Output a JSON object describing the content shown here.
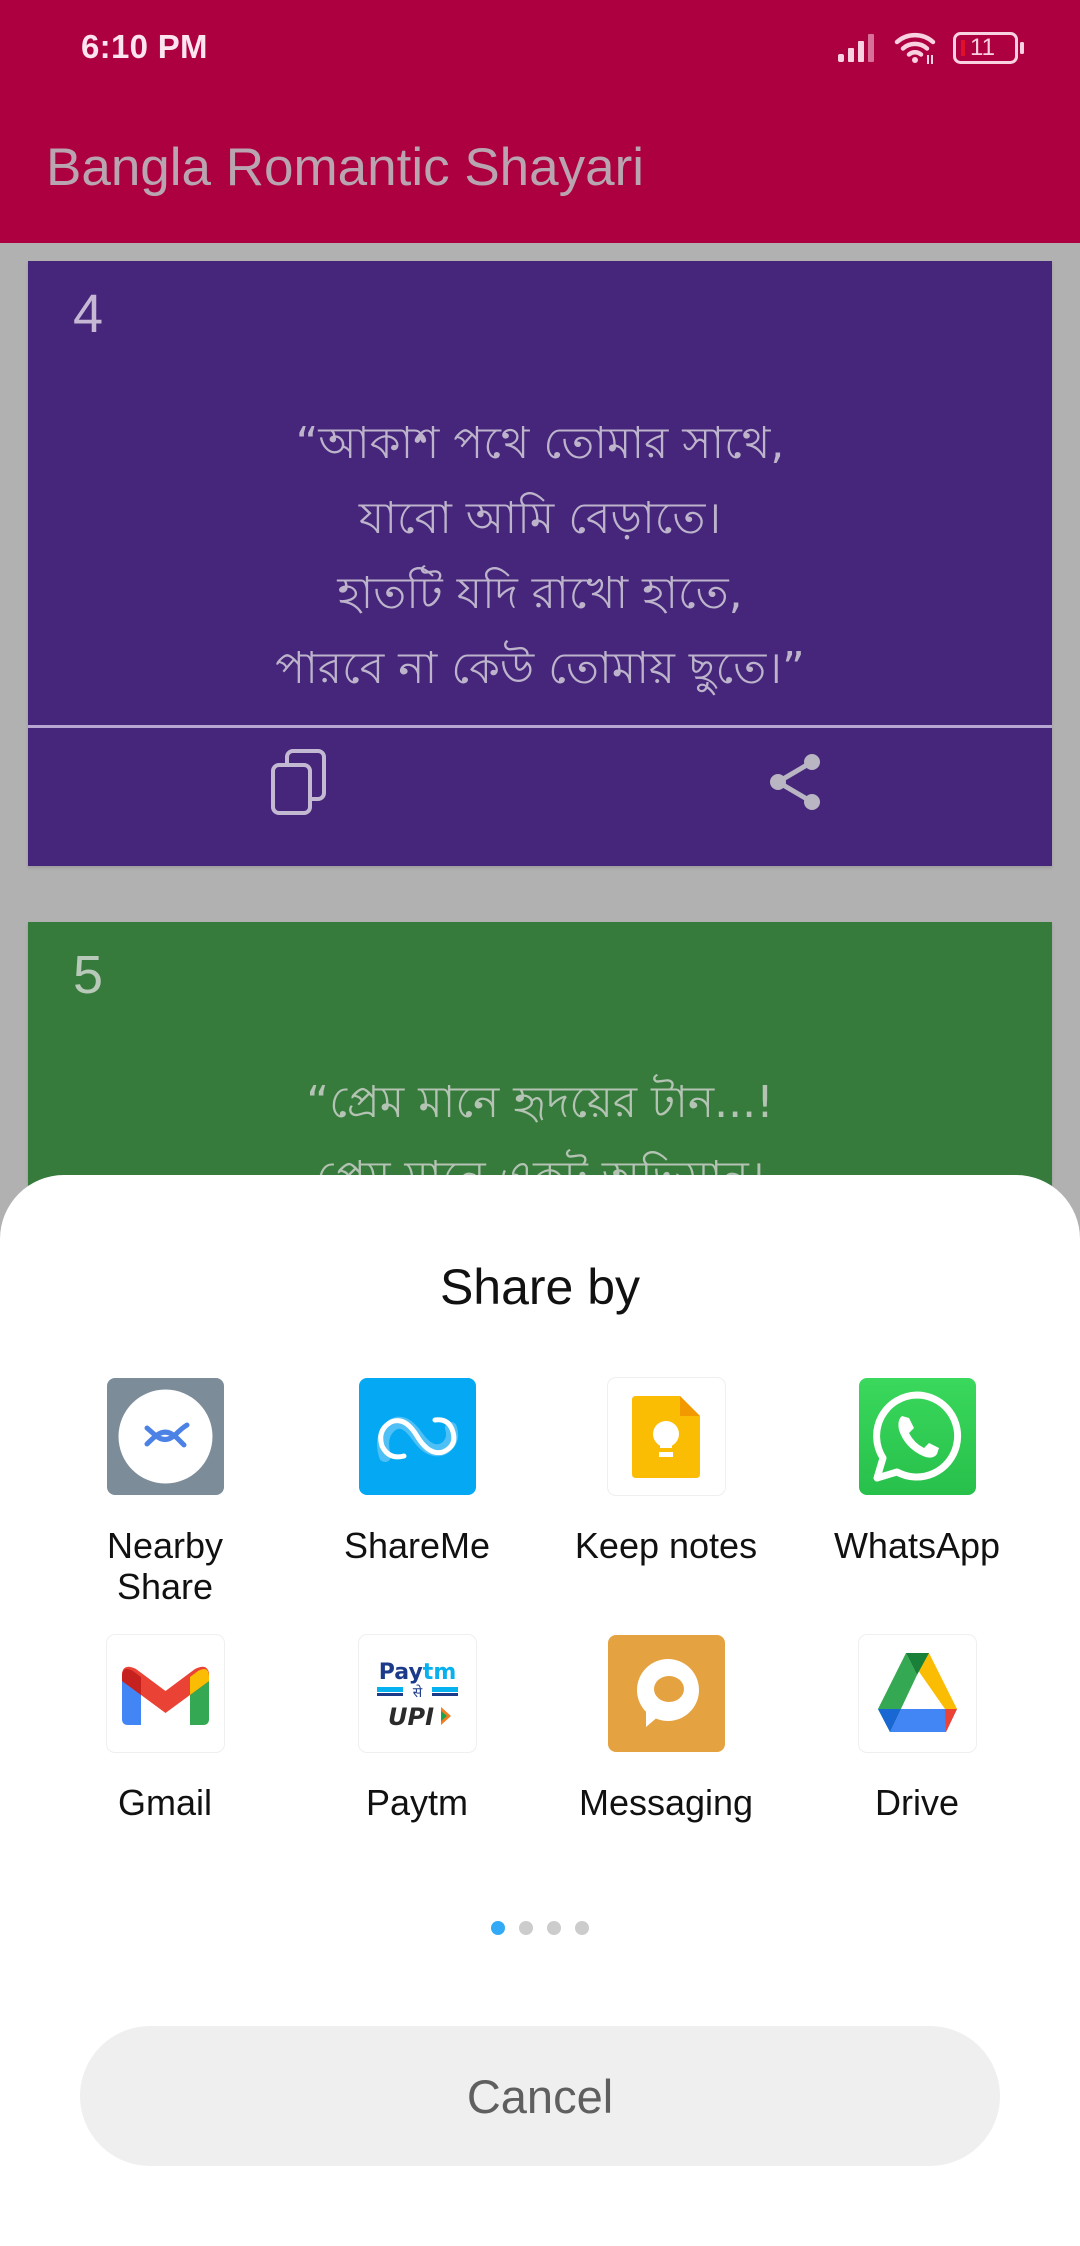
{
  "status_bar": {
    "time": "6:10 PM",
    "battery_level": "11",
    "signal_icon": "cellular-signal-icon",
    "wifi_icon": "wifi-icon",
    "battery_icon": "battery-icon"
  },
  "app_bar": {
    "title": "Bangla Romantic Shayari",
    "color": "#ad0040"
  },
  "cards": [
    {
      "number": "4",
      "color": "#45267a",
      "lines": [
        "“আকাশ পথে তোমার সাথে,",
        "যাবো আমি বেড়াতে।",
        "হাতটি যদি রাখো হাতে,",
        "পারবে না কেউ তোমায় ছুতে।”"
      ],
      "actions": [
        {
          "name": "copy",
          "icon": "copy-icon"
        },
        {
          "name": "share",
          "icon": "share-icon"
        }
      ]
    },
    {
      "number": "5",
      "color": "#377b3c",
      "lines": [
        "“প্রেম মানে হৃদয়ের টান...!",
        "প্রেম মানে একটু অভিমান।"
      ]
    }
  ],
  "share_sheet": {
    "title": "Share by",
    "apps": [
      {
        "label": "Nearby Share",
        "icon": "nearby-share-icon"
      },
      {
        "label": "ShareMe",
        "icon": "shareme-icon"
      },
      {
        "label": "Keep notes",
        "icon": "keep-notes-icon"
      },
      {
        "label": "WhatsApp",
        "icon": "whatsapp-icon"
      },
      {
        "label": "Gmail",
        "icon": "gmail-icon"
      },
      {
        "label": "Paytm",
        "icon": "paytm-icon"
      },
      {
        "label": "Messaging",
        "icon": "messaging-icon"
      },
      {
        "label": "Drive",
        "icon": "drive-icon"
      }
    ],
    "pagination": {
      "current_page": 1,
      "total_pages": 4,
      "active_color": "#33aaf5"
    },
    "cancel_label": "Cancel"
  }
}
